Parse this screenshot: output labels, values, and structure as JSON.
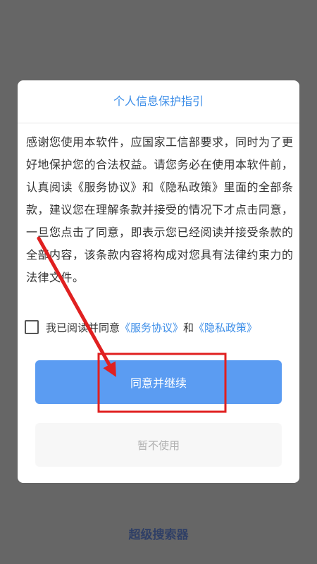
{
  "dialog": {
    "title": "个人信息保护指引",
    "body": "感谢您使用本软件，应国家工信部要求，同时为了更好地保护您的合法权益。请您务必在使用本软件前，认真阅读《服务协议》和《隐私政策》里面的全部条款，建议您在理解条款并接受的情况下才点击同意，一旦您点击了同意，即表示您已经阅读并接受条款的全部内容，该条款内容将构成对您具有法律约束力的法律文件。",
    "agree_prefix": "我已阅读并同意",
    "service_link": "《服务协议》",
    "and_text": "和",
    "privacy_link": "《隐私政策》",
    "agree_button": "同意并继续",
    "decline_button": "暂不使用"
  },
  "app": {
    "name": "超级搜索器"
  },
  "colors": {
    "accent": "#3d8ee8",
    "primary_button": "#5b9cf2",
    "annotation_red": "#e02020",
    "overlay": "#666666"
  }
}
